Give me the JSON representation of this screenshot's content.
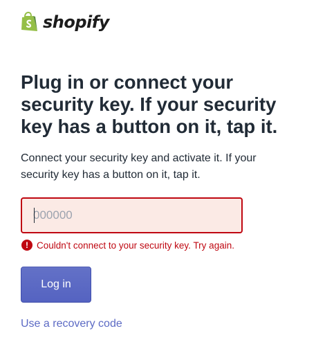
{
  "brand": {
    "logo_icon": "shopify-bag-icon",
    "name": "shopify"
  },
  "main": {
    "heading": "Plug in or connect your security key. If your security key has a button on it, tap it.",
    "subtitle": "Connect your security key and activate it. If your security key has a button on it, tap it."
  },
  "code_field": {
    "value": "",
    "placeholder": "000000"
  },
  "error": {
    "icon": "error-exclamation-icon",
    "message": "Couldn't connect to your security key. Try again."
  },
  "actions": {
    "login_label": "Log in",
    "recovery_link": "Use a recovery code"
  },
  "colors": {
    "brand_green": "#95bf47",
    "error_red": "#bf0711",
    "error_bg": "#fbeae5",
    "primary_indigo": "#5c6ac4"
  }
}
